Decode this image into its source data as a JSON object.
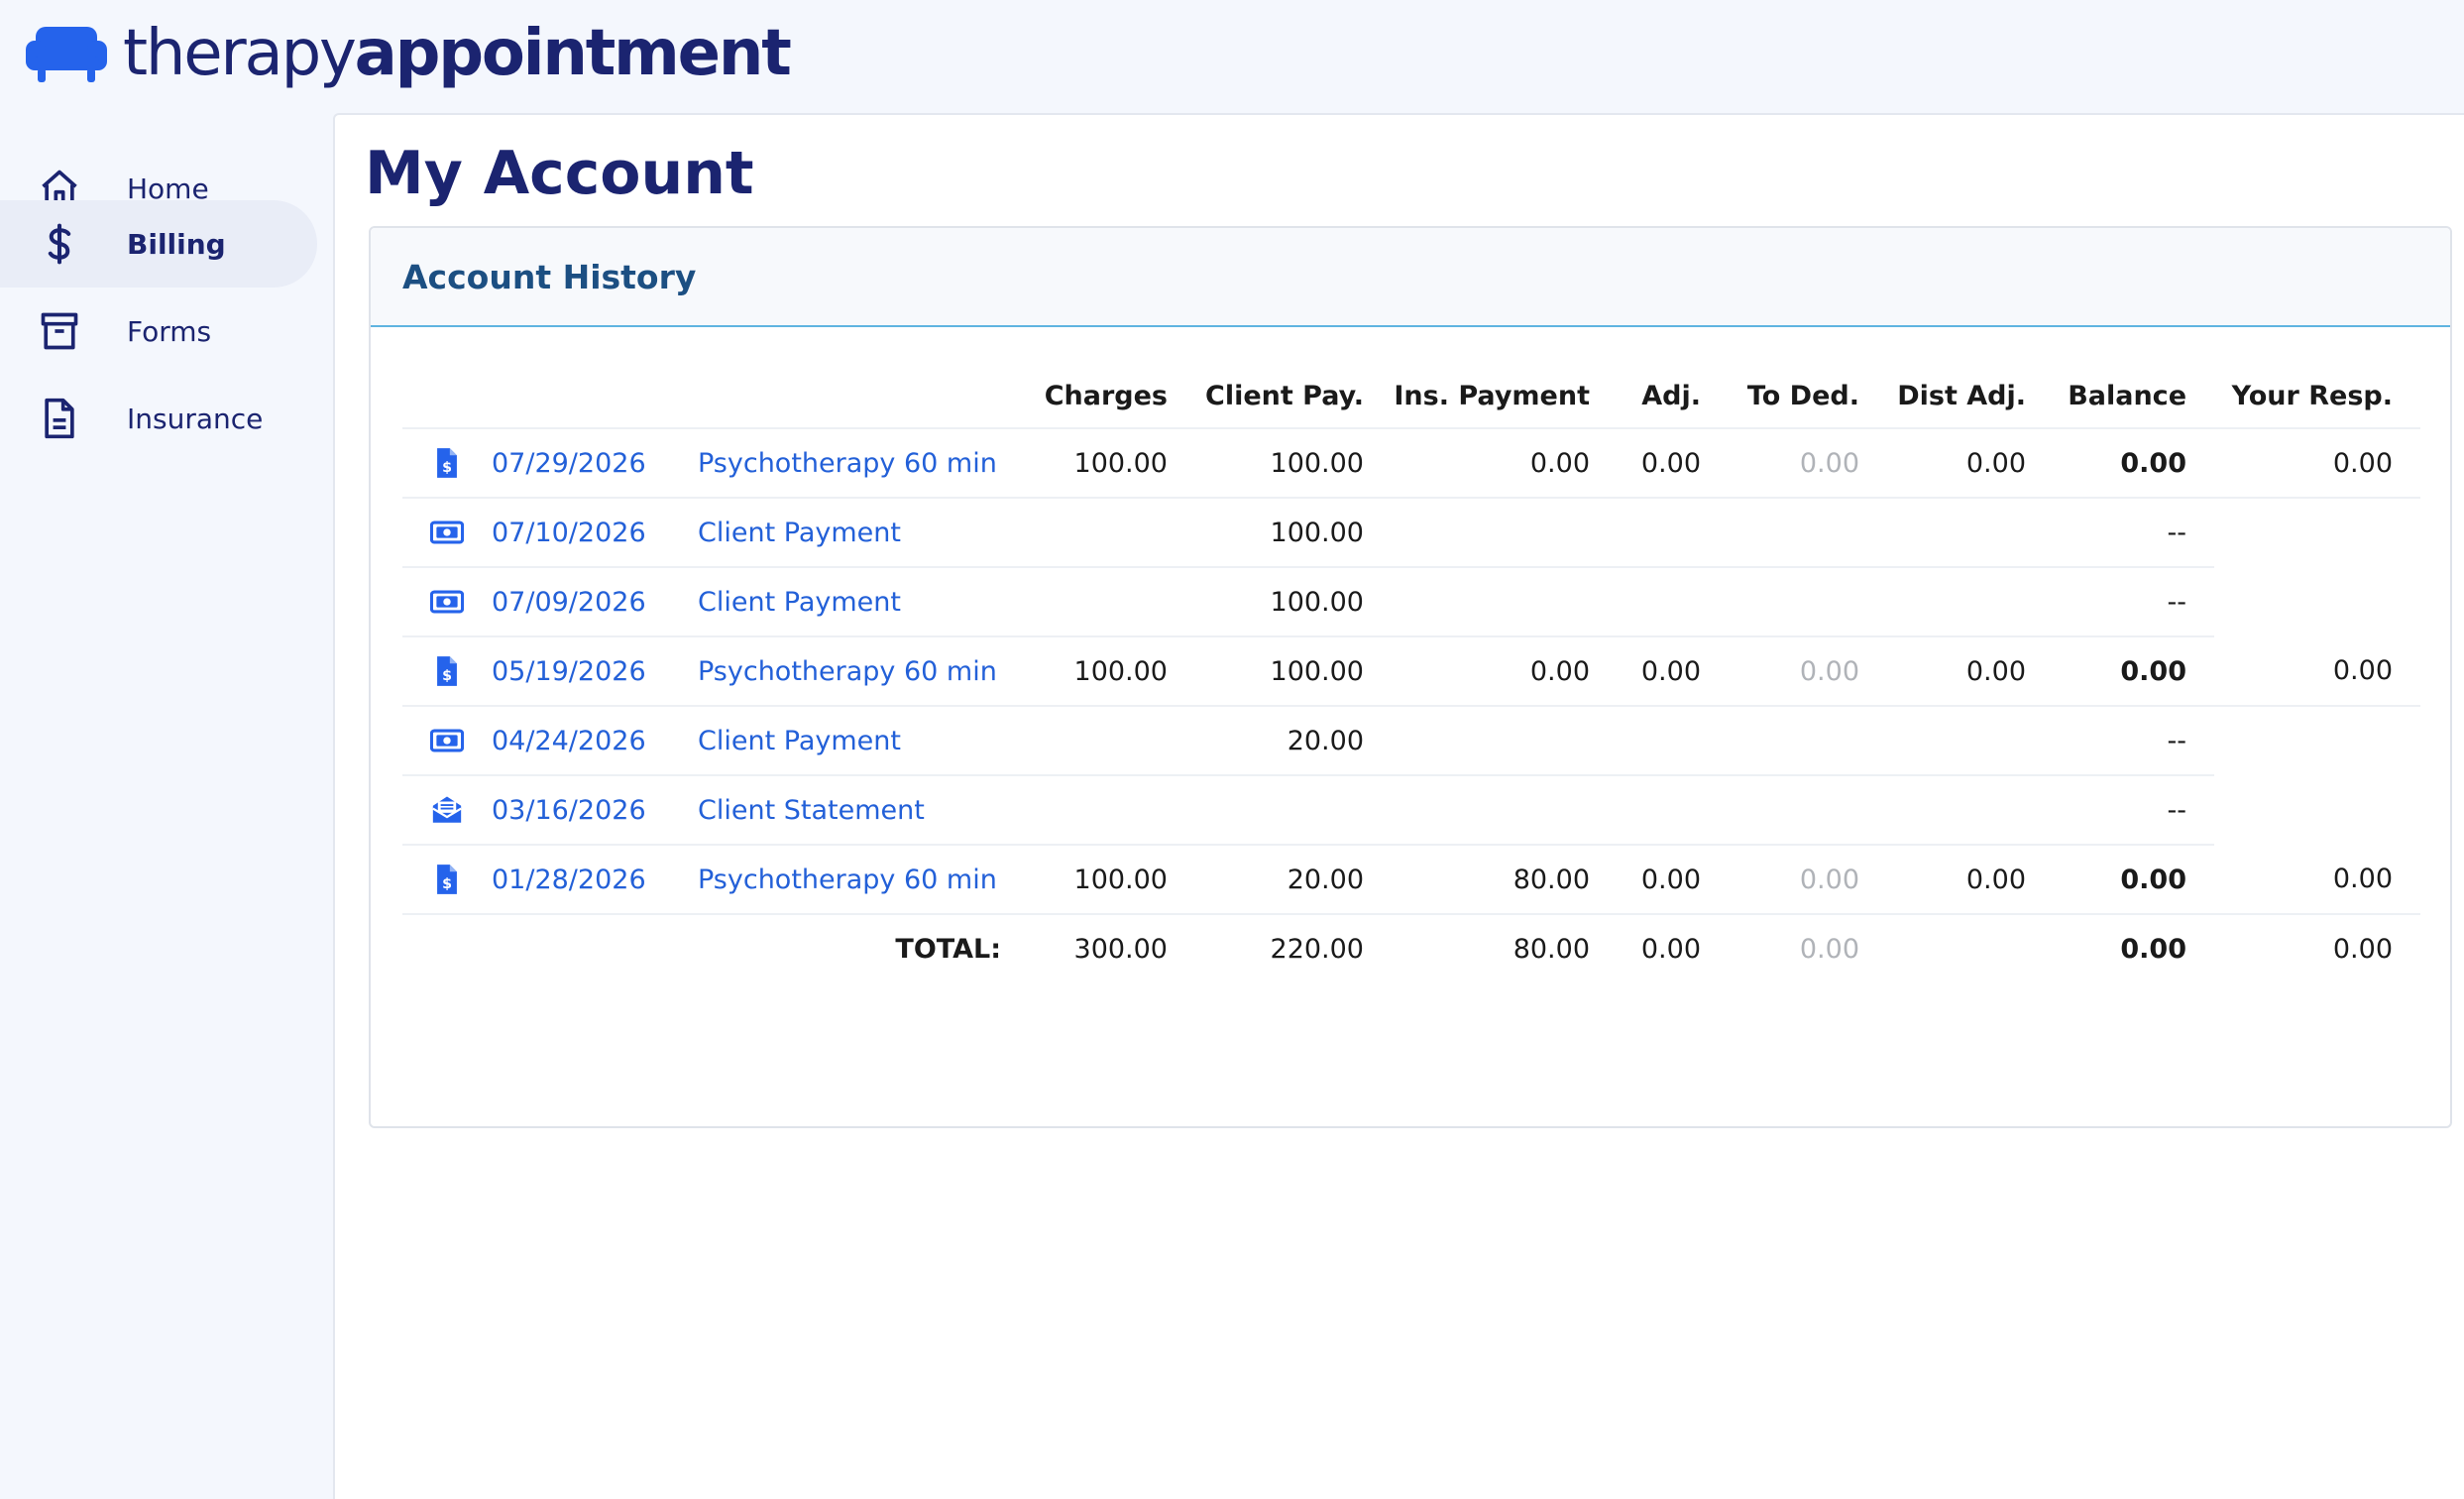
{
  "brand": {
    "name_light": "therapy",
    "name_bold": "appointment",
    "accent": "#2563eb",
    "navy": "#1b2470"
  },
  "sidebar": {
    "items": [
      {
        "label": "Home",
        "icon": "home-icon",
        "active": false
      },
      {
        "label": "Billing",
        "icon": "dollar-icon",
        "active": true
      },
      {
        "label": "Forms",
        "icon": "archive-box-icon",
        "active": false
      },
      {
        "label": "Insurance",
        "icon": "document-icon",
        "active": false
      }
    ]
  },
  "page": {
    "title": "My Account"
  },
  "account_history": {
    "title": "Account History",
    "columns": [
      "Charges",
      "Client Pay.",
      "Ins. Payment",
      "Adj.",
      "To Ded.",
      "Dist Adj.",
      "Balance",
      "Your Resp."
    ],
    "rows": [
      {
        "icon": "invoice-icon",
        "date": "07/29/2026",
        "description": "Psychotherapy 60 min",
        "charges": "100.00",
        "client_pay": "100.00",
        "ins_payment": "0.00",
        "adj": "0.00",
        "to_ded": "0.00",
        "dist_adj": "0.00",
        "balance": "0.00",
        "your_resp": "0.00"
      },
      {
        "icon": "cash-icon",
        "date": "07/10/2026",
        "description": "Client Payment",
        "charges": "",
        "client_pay": "100.00",
        "ins_payment": "",
        "adj": "",
        "to_ded": "",
        "dist_adj": "",
        "balance": "--",
        "your_resp": ""
      },
      {
        "icon": "cash-icon",
        "date": "07/09/2026",
        "description": "Client Payment",
        "charges": "",
        "client_pay": "100.00",
        "ins_payment": "",
        "adj": "",
        "to_ded": "",
        "dist_adj": "",
        "balance": "--",
        "your_resp": ""
      },
      {
        "icon": "invoice-icon",
        "date": "05/19/2026",
        "description": "Psychotherapy 60 min",
        "charges": "100.00",
        "client_pay": "100.00",
        "ins_payment": "0.00",
        "adj": "0.00",
        "to_ded": "0.00",
        "dist_adj": "0.00",
        "balance": "0.00",
        "your_resp": "0.00"
      },
      {
        "icon": "cash-icon",
        "date": "04/24/2026",
        "description": "Client Payment",
        "charges": "",
        "client_pay": "20.00",
        "ins_payment": "",
        "adj": "",
        "to_ded": "",
        "dist_adj": "",
        "balance": "--",
        "your_resp": ""
      },
      {
        "icon": "envelope-open-icon",
        "date": "03/16/2026",
        "description": "Client Statement",
        "charges": "",
        "client_pay": "",
        "ins_payment": "",
        "adj": "",
        "to_ded": "",
        "dist_adj": "",
        "balance": "--",
        "your_resp": ""
      },
      {
        "icon": "invoice-icon",
        "date": "01/28/2026",
        "description": "Psychotherapy 60 min",
        "charges": "100.00",
        "client_pay": "20.00",
        "ins_payment": "80.00",
        "adj": "0.00",
        "to_ded": "0.00",
        "dist_adj": "0.00",
        "balance": "0.00",
        "your_resp": "0.00"
      }
    ],
    "total": {
      "label": "TOTAL:",
      "charges": "300.00",
      "client_pay": "220.00",
      "ins_payment": "80.00",
      "adj": "0.00",
      "to_ded": "0.00",
      "dist_adj": "",
      "balance": "0.00",
      "your_resp": "0.00"
    }
  }
}
